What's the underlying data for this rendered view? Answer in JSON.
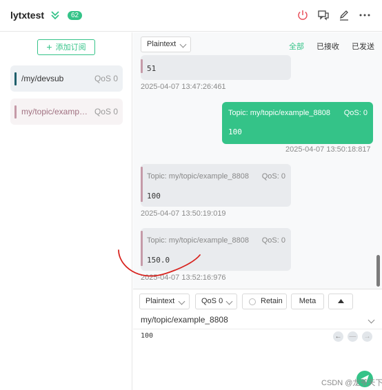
{
  "header": {
    "connection_name": "lytxtest",
    "badge_count": "62",
    "icons": [
      "chevron-double-down-icon",
      "power-icon",
      "chat-icon",
      "edit-icon",
      "more-icon"
    ],
    "accent_color": "#34c388",
    "power_color": "#e8505b"
  },
  "sidebar": {
    "add_subscription_label": "添加订阅",
    "subscriptions": [
      {
        "topic": "/my/devsub",
        "qos": "QoS 0",
        "color": "#1f5f6b"
      },
      {
        "topic": "my/topic/example_8808",
        "qos": "QoS 0",
        "color": "#c59aa8"
      }
    ]
  },
  "messages": {
    "format": "Plaintext",
    "filters": {
      "all": "全部",
      "received": "已接收",
      "sent": "已发送"
    },
    "items": [
      {
        "direction": "in",
        "payload": "51",
        "time": "2025-04-07 13:47:26:461"
      },
      {
        "direction": "out",
        "topic": "Topic: my/topic/example_8808",
        "qos": "QoS: 0",
        "payload": "100",
        "time": "2025-04-07 13:50:18:817"
      },
      {
        "direction": "in",
        "topic": "Topic: my/topic/example_8808",
        "qos": "QoS: 0",
        "payload": "100",
        "time": "2025-04-07 13:50:19:019"
      },
      {
        "direction": "in",
        "topic": "Topic: my/topic/example_8808",
        "qos": "QoS: 0",
        "payload": "150.0",
        "time": "2025-04-07 13:52:16:976"
      }
    ]
  },
  "publish": {
    "format": "Plaintext",
    "qos": "QoS 0",
    "retain_label": "Retain",
    "meta_label": "Meta",
    "topic": "my/topic/example_8808",
    "payload": "100"
  },
  "watermark": "CSDN @龙爷天下"
}
